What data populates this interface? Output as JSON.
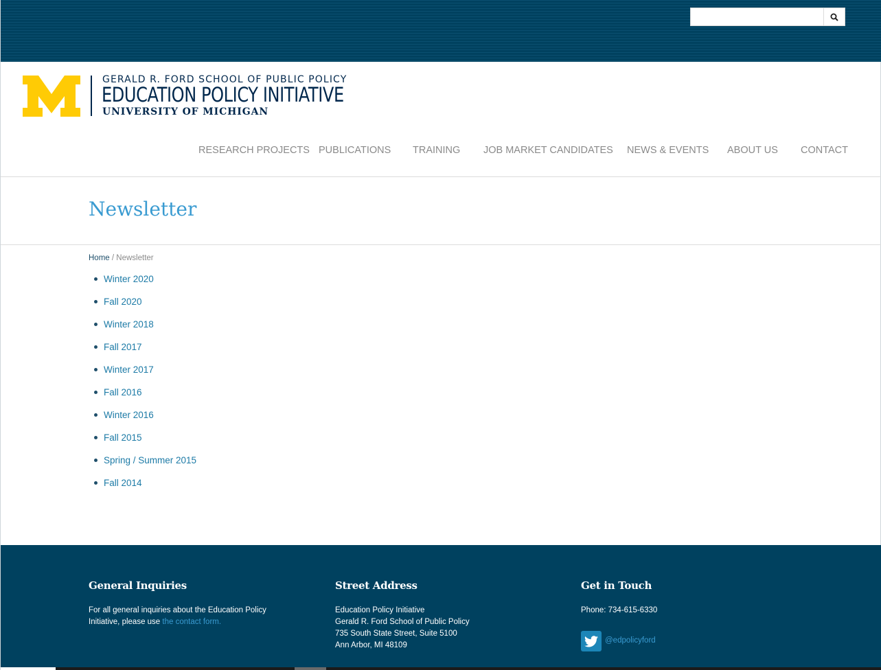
{
  "search": {
    "placeholder": ""
  },
  "logo": {
    "block_m": "M",
    "line1": "GERALD R. FORD SCHOOL OF PUBLIC POLICY",
    "line2": "EDUCATION POLICY INITIATIVE",
    "line3": "UNIVERSITY OF MICHIGAN",
    "m_color": "#ffcb05",
    "text_color": "#00274c"
  },
  "nav": {
    "items": [
      {
        "label": "RESEARCH PROJECTS"
      },
      {
        "label": "PUBLICATIONS"
      },
      {
        "label": "TRAINING"
      },
      {
        "label": "JOB MARKET CANDIDATES"
      },
      {
        "label": "NEWS & EVENTS"
      },
      {
        "label": "ABOUT US"
      },
      {
        "label": "CONTACT"
      }
    ]
  },
  "page": {
    "title": "Newsletter"
  },
  "breadcrumb": {
    "home": "Home",
    "separator": "/",
    "current": "Newsletter"
  },
  "newsletters": [
    {
      "label": "Winter 2020"
    },
    {
      "label": "Fall 2020"
    },
    {
      "label": "Winter 2018"
    },
    {
      "label": "Fall 2017"
    },
    {
      "label": "Winter 2017"
    },
    {
      "label": "Fall 2016"
    },
    {
      "label": "Winter 2016"
    },
    {
      "label": "Fall 2015"
    },
    {
      "label": "Spring / Summer 2015"
    },
    {
      "label": "Fall 2014"
    }
  ],
  "footer": {
    "general": {
      "heading": "General Inquiries",
      "text_line1": "For all general inquiries about the Education Policy",
      "text_line2": "Initiative, please use",
      "link": "the contact form."
    },
    "address": {
      "heading": "Street Address",
      "line1": "Education Policy Initiative",
      "line2": "Gerald R. Ford School of Public Policy",
      "line3": "735 South State Street, Suite 5100",
      "line4": "Ann Arbor, MI 48109"
    },
    "contact": {
      "heading": "Get in Touch",
      "phone": "Phone: 734-615-6330",
      "twitter": "@edpolicyford"
    }
  },
  "colors": {
    "brand_navy": "#00415f",
    "link_blue": "#1c7aa6",
    "title_blue": "#3a9bd1",
    "maize": "#ffcb05"
  }
}
